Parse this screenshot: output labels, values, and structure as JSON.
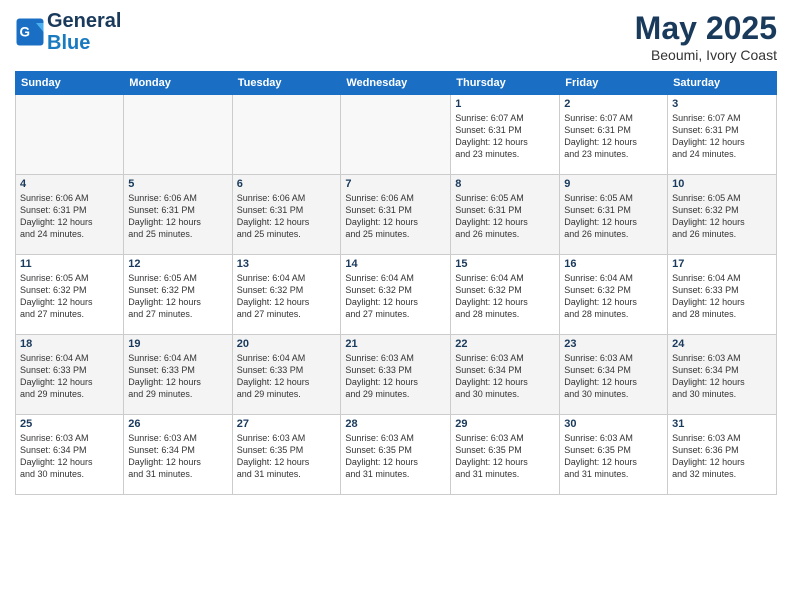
{
  "logo": {
    "line1": "General",
    "line2": "Blue"
  },
  "title": "May 2025",
  "subtitle": "Beoumi, Ivory Coast",
  "days_of_week": [
    "Sunday",
    "Monday",
    "Tuesday",
    "Wednesday",
    "Thursday",
    "Friday",
    "Saturday"
  ],
  "weeks": [
    [
      {
        "day": "",
        "info": "",
        "empty": true
      },
      {
        "day": "",
        "info": "",
        "empty": true
      },
      {
        "day": "",
        "info": "",
        "empty": true
      },
      {
        "day": "",
        "info": "",
        "empty": true
      },
      {
        "day": "1",
        "info": "Sunrise: 6:07 AM\nSunset: 6:31 PM\nDaylight: 12 hours\nand 23 minutes.",
        "empty": false
      },
      {
        "day": "2",
        "info": "Sunrise: 6:07 AM\nSunset: 6:31 PM\nDaylight: 12 hours\nand 23 minutes.",
        "empty": false
      },
      {
        "day": "3",
        "info": "Sunrise: 6:07 AM\nSunset: 6:31 PM\nDaylight: 12 hours\nand 24 minutes.",
        "empty": false
      }
    ],
    [
      {
        "day": "4",
        "info": "Sunrise: 6:06 AM\nSunset: 6:31 PM\nDaylight: 12 hours\nand 24 minutes.",
        "empty": false
      },
      {
        "day": "5",
        "info": "Sunrise: 6:06 AM\nSunset: 6:31 PM\nDaylight: 12 hours\nand 25 minutes.",
        "empty": false
      },
      {
        "day": "6",
        "info": "Sunrise: 6:06 AM\nSunset: 6:31 PM\nDaylight: 12 hours\nand 25 minutes.",
        "empty": false
      },
      {
        "day": "7",
        "info": "Sunrise: 6:06 AM\nSunset: 6:31 PM\nDaylight: 12 hours\nand 25 minutes.",
        "empty": false
      },
      {
        "day": "8",
        "info": "Sunrise: 6:05 AM\nSunset: 6:31 PM\nDaylight: 12 hours\nand 26 minutes.",
        "empty": false
      },
      {
        "day": "9",
        "info": "Sunrise: 6:05 AM\nSunset: 6:31 PM\nDaylight: 12 hours\nand 26 minutes.",
        "empty": false
      },
      {
        "day": "10",
        "info": "Sunrise: 6:05 AM\nSunset: 6:32 PM\nDaylight: 12 hours\nand 26 minutes.",
        "empty": false
      }
    ],
    [
      {
        "day": "11",
        "info": "Sunrise: 6:05 AM\nSunset: 6:32 PM\nDaylight: 12 hours\nand 27 minutes.",
        "empty": false
      },
      {
        "day": "12",
        "info": "Sunrise: 6:05 AM\nSunset: 6:32 PM\nDaylight: 12 hours\nand 27 minutes.",
        "empty": false
      },
      {
        "day": "13",
        "info": "Sunrise: 6:04 AM\nSunset: 6:32 PM\nDaylight: 12 hours\nand 27 minutes.",
        "empty": false
      },
      {
        "day": "14",
        "info": "Sunrise: 6:04 AM\nSunset: 6:32 PM\nDaylight: 12 hours\nand 27 minutes.",
        "empty": false
      },
      {
        "day": "15",
        "info": "Sunrise: 6:04 AM\nSunset: 6:32 PM\nDaylight: 12 hours\nand 28 minutes.",
        "empty": false
      },
      {
        "day": "16",
        "info": "Sunrise: 6:04 AM\nSunset: 6:32 PM\nDaylight: 12 hours\nand 28 minutes.",
        "empty": false
      },
      {
        "day": "17",
        "info": "Sunrise: 6:04 AM\nSunset: 6:33 PM\nDaylight: 12 hours\nand 28 minutes.",
        "empty": false
      }
    ],
    [
      {
        "day": "18",
        "info": "Sunrise: 6:04 AM\nSunset: 6:33 PM\nDaylight: 12 hours\nand 29 minutes.",
        "empty": false
      },
      {
        "day": "19",
        "info": "Sunrise: 6:04 AM\nSunset: 6:33 PM\nDaylight: 12 hours\nand 29 minutes.",
        "empty": false
      },
      {
        "day": "20",
        "info": "Sunrise: 6:04 AM\nSunset: 6:33 PM\nDaylight: 12 hours\nand 29 minutes.",
        "empty": false
      },
      {
        "day": "21",
        "info": "Sunrise: 6:03 AM\nSunset: 6:33 PM\nDaylight: 12 hours\nand 29 minutes.",
        "empty": false
      },
      {
        "day": "22",
        "info": "Sunrise: 6:03 AM\nSunset: 6:34 PM\nDaylight: 12 hours\nand 30 minutes.",
        "empty": false
      },
      {
        "day": "23",
        "info": "Sunrise: 6:03 AM\nSunset: 6:34 PM\nDaylight: 12 hours\nand 30 minutes.",
        "empty": false
      },
      {
        "day": "24",
        "info": "Sunrise: 6:03 AM\nSunset: 6:34 PM\nDaylight: 12 hours\nand 30 minutes.",
        "empty": false
      }
    ],
    [
      {
        "day": "25",
        "info": "Sunrise: 6:03 AM\nSunset: 6:34 PM\nDaylight: 12 hours\nand 30 minutes.",
        "empty": false
      },
      {
        "day": "26",
        "info": "Sunrise: 6:03 AM\nSunset: 6:34 PM\nDaylight: 12 hours\nand 31 minutes.",
        "empty": false
      },
      {
        "day": "27",
        "info": "Sunrise: 6:03 AM\nSunset: 6:35 PM\nDaylight: 12 hours\nand 31 minutes.",
        "empty": false
      },
      {
        "day": "28",
        "info": "Sunrise: 6:03 AM\nSunset: 6:35 PM\nDaylight: 12 hours\nand 31 minutes.",
        "empty": false
      },
      {
        "day": "29",
        "info": "Sunrise: 6:03 AM\nSunset: 6:35 PM\nDaylight: 12 hours\nand 31 minutes.",
        "empty": false
      },
      {
        "day": "30",
        "info": "Sunrise: 6:03 AM\nSunset: 6:35 PM\nDaylight: 12 hours\nand 31 minutes.",
        "empty": false
      },
      {
        "day": "31",
        "info": "Sunrise: 6:03 AM\nSunset: 6:36 PM\nDaylight: 12 hours\nand 32 minutes.",
        "empty": false
      }
    ]
  ]
}
